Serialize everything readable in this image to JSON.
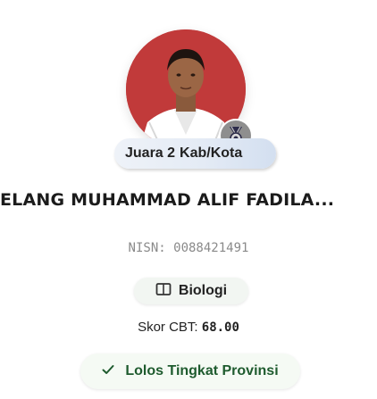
{
  "profile": {
    "rank_prefix": "Juara 2",
    "rank_level": "Kab/Kota",
    "name": "ELANG MUHAMMAD ALIF FADILA...",
    "nisn_label": "NISN:",
    "nisn_value": "0088421491",
    "subject": "Biologi",
    "subject_icon": "book-icon",
    "score_label": "Skor CBT:",
    "score_value": "68.00",
    "status_label": "Lolos Tingkat Provinsi",
    "status_icon": "check-icon",
    "medal_icon": "medal-icon"
  },
  "colors": {
    "avatar_bg": "#c13a3a",
    "medal_bg": "#8e8e8e",
    "status_text": "#1e5b2e",
    "muted_text": "#8a8a8a"
  }
}
